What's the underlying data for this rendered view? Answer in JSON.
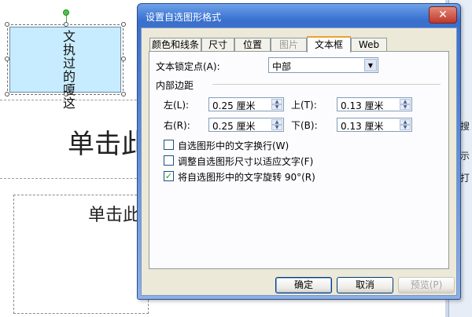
{
  "slide": {
    "textbox_text": "文执过的嗄这",
    "title_placeholder": "单击此",
    "subtitle_placeholder": "单击此"
  },
  "right_panel": {
    "items": [
      "搜",
      "示",
      "打"
    ]
  },
  "dialog": {
    "title": "设置自选图形格式",
    "close_glyph": "✕",
    "tabs": [
      {
        "label": "颜色和线条",
        "state": "normal"
      },
      {
        "label": "尺寸",
        "state": "normal"
      },
      {
        "label": "位置",
        "state": "normal"
      },
      {
        "label": "图片",
        "state": "disabled"
      },
      {
        "label": "文本框",
        "state": "active"
      },
      {
        "label": "Web",
        "state": "normal"
      }
    ],
    "anchor_label": "文本锁定点(A):",
    "anchor_value": "中部",
    "internal_margin_label": "内部边距",
    "margins": {
      "left_label": "左(L):",
      "left_value": "0.25 厘米",
      "right_label": "右(R):",
      "right_value": "0.25 厘米",
      "top_label": "上(T):",
      "top_value": "0.13 厘米",
      "bottom_label": "下(B):",
      "bottom_value": "0.13 厘米"
    },
    "options": [
      {
        "label": "自选图形中的文字换行(W)",
        "checked": false
      },
      {
        "label": "调整自选图形尺寸以适应文字(F)",
        "checked": false
      },
      {
        "label": "将自选图形中的文字旋转 90°(R)",
        "checked": true
      }
    ],
    "buttons": {
      "ok": "确定",
      "cancel": "取消",
      "preview": "预览(P)"
    }
  }
}
